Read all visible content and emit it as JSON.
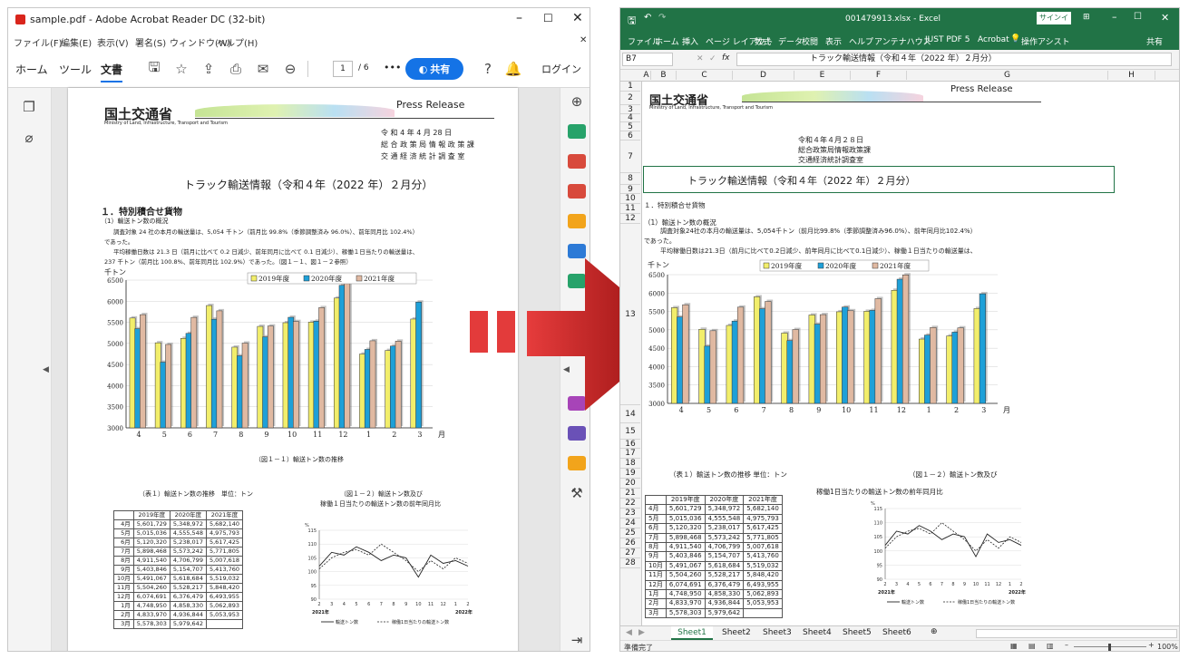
{
  "acrobat": {
    "title": "sample.pdf - Adobe Acrobat Reader DC (32-bit)",
    "menu": [
      "ファイル(F)",
      "編集(E)",
      "表示(V)",
      "署名(S)",
      "ウィンドウ(W)",
      "ヘルプ(H)"
    ],
    "tabs": [
      "ホーム",
      "ツール",
      "文書"
    ],
    "page_current": "1",
    "page_total": "/ 6",
    "share_label": "共有",
    "login_label": "ログイン",
    "more_label": "•••"
  },
  "pdf": {
    "ministry_jp": "国土交通省",
    "ministry_en": "Ministry of Land, Infrastructure, Transport and Tourism",
    "press_release": "Press Release",
    "date": "令 和 4 年 4 月 28 日",
    "dept1": "総 合 政 策 局 情 報 政 策 課",
    "dept2": "交 通 経 済 統 計 調 査 室",
    "title": "トラック輸送情報（令和４年（2022 年）２月分）",
    "section": "１．特別積合せ貨物",
    "sub": "（1）輸送トン数の概況",
    "para1": "調査対象 24 社の本月の輸送量は、5,054 千トン（前月比 99.8%（季節調整済み 96.0%）、前年同月比 102.4%）",
    "para1b": "であった。",
    "para2": "平均稼働日数は 21.3 日（前月に比べて 0.2 日減少、前年同月に比べて 0.1 日減少）、稼働１日当たりの輸送量は、",
    "para2b": "237 千トン（前月比 100.8%、前年同月比 102.9%）であった。（図１－１、図１－２参照）",
    "chart_unit": "千トン",
    "month_suffix": "月",
    "fig_caption": "（図１－１）輸送トン数の推移",
    "table_caption": "（表１）輸送トン数の推移　単位：トン",
    "fig2_caption1": "（図１－２）輸送トン数及び",
    "fig2_caption2": "稼働１日当たりの輸送トン数の前年同月比"
  },
  "excel": {
    "title": "001479913.xlsx - Excel",
    "signin": "サインイン",
    "ribbon": [
      "ファイル",
      "ホーム",
      "挿入",
      "ページ レイアウト",
      "数式",
      "データ",
      "校閲",
      "表示",
      "ヘルプ",
      "アンテナハウス",
      "JUST PDF 5",
      "Acrobat",
      "操作アシスト",
      "共有"
    ],
    "cellref": "B7",
    "fx": "fx",
    "formula": "トラック輸送情報（令和４年（2022 年）２月分）",
    "columns": [
      "A",
      "B",
      "C",
      "D",
      "E",
      "F",
      "G",
      "H"
    ],
    "rows": [
      "1",
      "2",
      "3",
      "4",
      "5",
      "6",
      "7",
      "8",
      "9",
      "10",
      "11",
      "12",
      "13",
      "14",
      "15",
      "16",
      "17",
      "18",
      "19",
      "20",
      "21",
      "22",
      "23",
      "24",
      "25",
      "26",
      "27",
      "28"
    ],
    "date": "令和４年４月２８日",
    "dept1": "総合政策局情報政策課",
    "dept2": "交通経済統計調査室",
    "title_cell": "トラック輸送情報（令和４年（2022 年）２月分）",
    "r8": "１．特別積合せ貨物",
    "r9": "（1）輸送トン数の概況",
    "r10": "調査対象24社の本月の輸送量は、5,054千トン（前月比99.8%（季節調整済み96.0%）、前年同月比102.4%）",
    "r11": "であった。",
    "r12": "平均稼働日数は21.3日（前月に比べて0.2日減少、前年同月に比べて0.1日減少）、稼働１日当たりの輸送量は、",
    "r15a": "（表１）輸送トン数の推移 単位：トン",
    "r15b": "（図１－２）輸送トン数及び",
    "r16": "稼働1日当たりの輸送トン数の前年同月比",
    "sheets": [
      "Sheet1",
      "Sheet2",
      "Sheet3",
      "Sheet4",
      "Sheet5",
      "Sheet6"
    ],
    "status": "準備完了",
    "zoom": "100%"
  },
  "table1": {
    "headers": [
      "",
      "2019年度",
      "2020年度",
      "2021年度"
    ],
    "rows": [
      [
        "4月",
        "5,601,729",
        "5,348,972",
        "5,682,140"
      ],
      [
        "5月",
        "5,015,036",
        "4,555,548",
        "4,975,793"
      ],
      [
        "6月",
        "5,120,320",
        "5,238,017",
        "5,617,425"
      ],
      [
        "7月",
        "5,898,468",
        "5,573,242",
        "5,771,805"
      ],
      [
        "8月",
        "4,911,540",
        "4,706,799",
        "5,007,618"
      ],
      [
        "9月",
        "5,403,846",
        "5,154,707",
        "5,413,760"
      ],
      [
        "10月",
        "5,491,067",
        "5,618,684",
        "5,519,032"
      ],
      [
        "11月",
        "5,504,260",
        "5,528,217",
        "5,848,420"
      ],
      [
        "12月",
        "6,074,691",
        "6,376,479",
        "6,493,955"
      ],
      [
        "1月",
        "4,748,950",
        "4,858,330",
        "5,062,893"
      ],
      [
        "2月",
        "4,833,970",
        "4,936,844",
        "5,053,953"
      ],
      [
        "3月",
        "5,578,303",
        "5,979,642",
        ""
      ]
    ]
  },
  "chart_data": [
    {
      "type": "bar",
      "ylabel": "千トン",
      "categories": [
        "4",
        "5",
        "6",
        "7",
        "8",
        "9",
        "10",
        "11",
        "12",
        "1",
        "2",
        "3"
      ],
      "ylim": [
        3000,
        6500
      ],
      "ticks": [
        "6500",
        "6000",
        "5500",
        "5000",
        "4500",
        "4000",
        "3500",
        "3000"
      ],
      "series": [
        {
          "name": "2019年度",
          "color": "#f2ee6b",
          "values": [
            5602,
            5015,
            5120,
            5898,
            4912,
            5404,
            5491,
            5504,
            6075,
            4749,
            4834,
            5578
          ]
        },
        {
          "name": "2020年度",
          "color": "#1ea0d8",
          "values": [
            5349,
            4556,
            5238,
            5573,
            4707,
            5155,
            5619,
            5528,
            6376,
            4858,
            4937,
            5980
          ]
        },
        {
          "name": "2021年度",
          "color": "#e0b9a2",
          "values": [
            5682,
            4976,
            5617,
            5772,
            5008,
            5414,
            5519,
            5848,
            6494,
            5063,
            5054,
            null
          ]
        }
      ],
      "legend": "top"
    },
    {
      "type": "line",
      "ylabel": "%",
      "x": [
        "2",
        "3",
        "4",
        "5",
        "6",
        "7",
        "8",
        "9",
        "10",
        "11",
        "12",
        "1",
        "2"
      ],
      "ylim": [
        90,
        115
      ],
      "ticks": [
        "115",
        "110",
        "105",
        "100",
        "95",
        "90"
      ],
      "xyear_left": "2021年",
      "xyear_right": "2022年",
      "series": [
        {
          "name": "輸送トン数",
          "values": [
            102,
            107,
            106,
            109,
            107,
            104,
            106,
            105,
            98,
            106,
            103,
            104,
            102
          ]
        },
        {
          "name": "稼働1日当たりの輸送トン数",
          "values": [
            101,
            105,
            107,
            108,
            106,
            110,
            107,
            104,
            100,
            104,
            101,
            105,
            103
          ]
        }
      ]
    }
  ]
}
